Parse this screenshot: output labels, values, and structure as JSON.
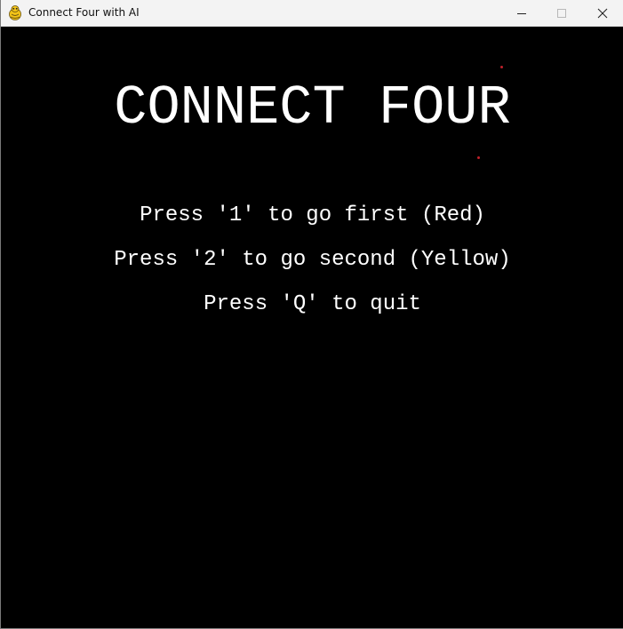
{
  "window": {
    "title": "Connect Four with AI",
    "icon": "pygame-snake-icon",
    "controls": [
      "minimize-icon",
      "maximize-icon",
      "close-icon"
    ]
  },
  "game": {
    "title": "CONNECT FOUR",
    "options": [
      "Press '1' to go first (Red)",
      "Press '2' to go second (Yellow)",
      "Press 'Q' to quit"
    ]
  },
  "colors": {
    "background": "#000000",
    "text": "#ffffff",
    "particle": "#c0202a",
    "titlebar": "#f3f3f3"
  }
}
